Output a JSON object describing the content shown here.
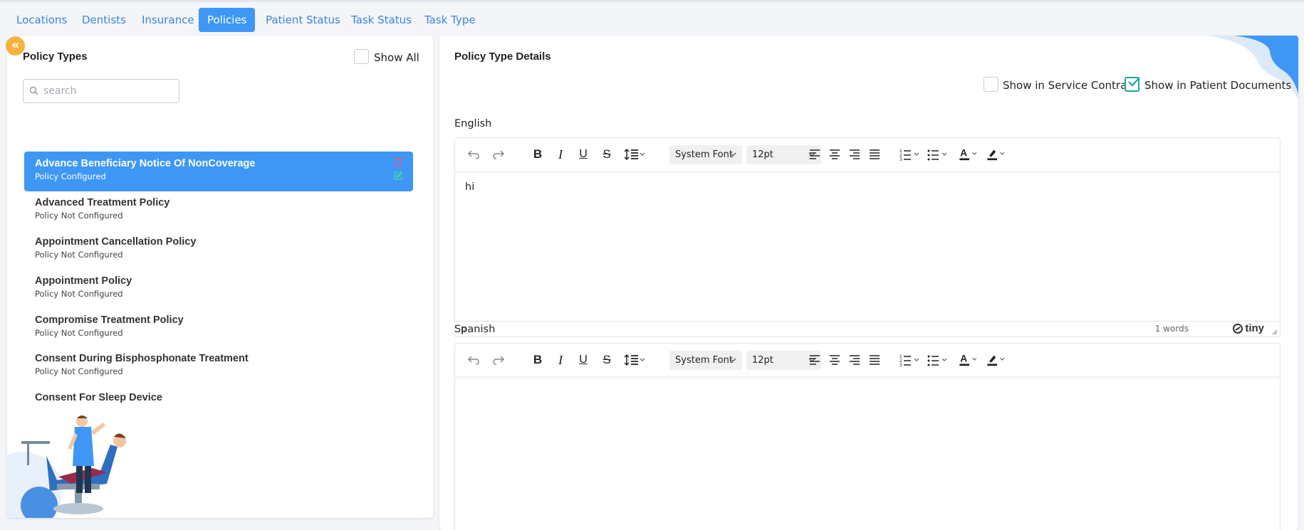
{
  "tabs": [
    {
      "label": "Locations"
    },
    {
      "label": "Dentists"
    },
    {
      "label": "Insurance"
    },
    {
      "label": "Policies",
      "active": true
    },
    {
      "label": "Patient Status"
    },
    {
      "label": "Task Status"
    },
    {
      "label": "Task Type"
    }
  ],
  "left": {
    "title": "Policy Types",
    "show_all_label": "Show All",
    "show_all_checked": false,
    "search_placeholder": "search",
    "search_value": "",
    "policies": [
      {
        "name": "Advance Beneficiary Notice Of NonCoverage",
        "status": "Policy Configured",
        "selected": true
      },
      {
        "name": "Advanced Treatment Policy",
        "status": "Policy Not Configured"
      },
      {
        "name": "Appointment Cancellation Policy",
        "status": "Policy Not Configured"
      },
      {
        "name": "Appointment Policy",
        "status": "Policy Not Configured"
      },
      {
        "name": "Compromise Treatment Policy",
        "status": "Policy Not Configured"
      },
      {
        "name": "Consent During Bisphosphonate Treatment",
        "status": "Policy Not Configured"
      },
      {
        "name": "Consent For Sleep Device",
        "status": ""
      }
    ]
  },
  "right": {
    "title": "Policy Type Details",
    "show_in_service_contract_label": "Show in Service Contract",
    "show_in_service_contract_checked": false,
    "show_in_patient_documents_label": "Show in Patient Documents",
    "show_in_patient_documents_checked": true,
    "english_label": "English",
    "spanish_label": "Spanish",
    "editor": {
      "font_family": "System Font",
      "font_size": "12pt"
    },
    "english_content": "hi",
    "english_status_path": "p",
    "english_word_count": "1 words",
    "tiny_brand": "tiny",
    "spanish_content": ""
  },
  "colors": {
    "accent": "#3e97f5",
    "tab_text": "#3b86d8",
    "checkbox_checked": "#1fa69a",
    "collapse_button": "#f4b33b"
  }
}
